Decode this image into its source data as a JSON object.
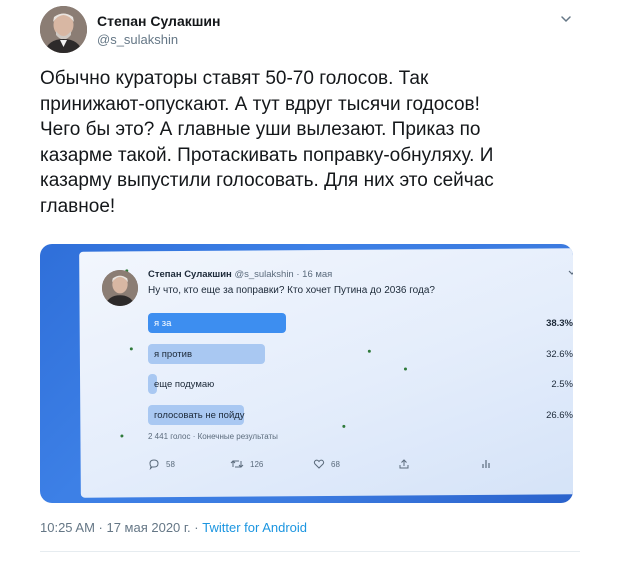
{
  "author": {
    "name": "Степан Сулакшин",
    "handle": "@s_sulakshin"
  },
  "tweet": {
    "text": "Обычно кураторы ставят 50-70 голосов. Так\nпринижают-опускают. А тут вдруг тысячи годосов!\nЧего бы это? А главные уши вылезают. Приказ по\nказарме такой. Протаскивать поправку-обнуляху. И\nказарму выпустили голосовать. Для них это сейчас\nглавное!",
    "timestamp": "10:25 AM · 17 мая 2020 г.",
    "separator": " · ",
    "source": "Twitter for Android"
  },
  "embedded": {
    "name": "Степан Сулакшин",
    "meta": "@s_sulakshin · 16 мая",
    "question": "Ну что, кто еще за поправки? Кто хочет Путина до 2036 года?",
    "poll": [
      {
        "label": "я за",
        "percent": "38.3%",
        "value": 38.3,
        "leader": true
      },
      {
        "label": "я против",
        "percent": "32.6%",
        "value": 32.6,
        "leader": false
      },
      {
        "label": "еще подумаю",
        "percent": "2.5%",
        "value": 2.5,
        "leader": false
      },
      {
        "label": "голосовать не пойду",
        "percent": "26.6%",
        "value": 26.6,
        "leader": false
      }
    ],
    "footer": "2 441 голос · Конечные результаты",
    "actions": {
      "reply": "58",
      "retweet": "126",
      "like": "68"
    }
  },
  "colors": {
    "accent": "#1b95e0",
    "poll_leader": "#3d8ef0",
    "poll_other": "#a9c8f2",
    "photo_frame": "#3c7be0"
  }
}
